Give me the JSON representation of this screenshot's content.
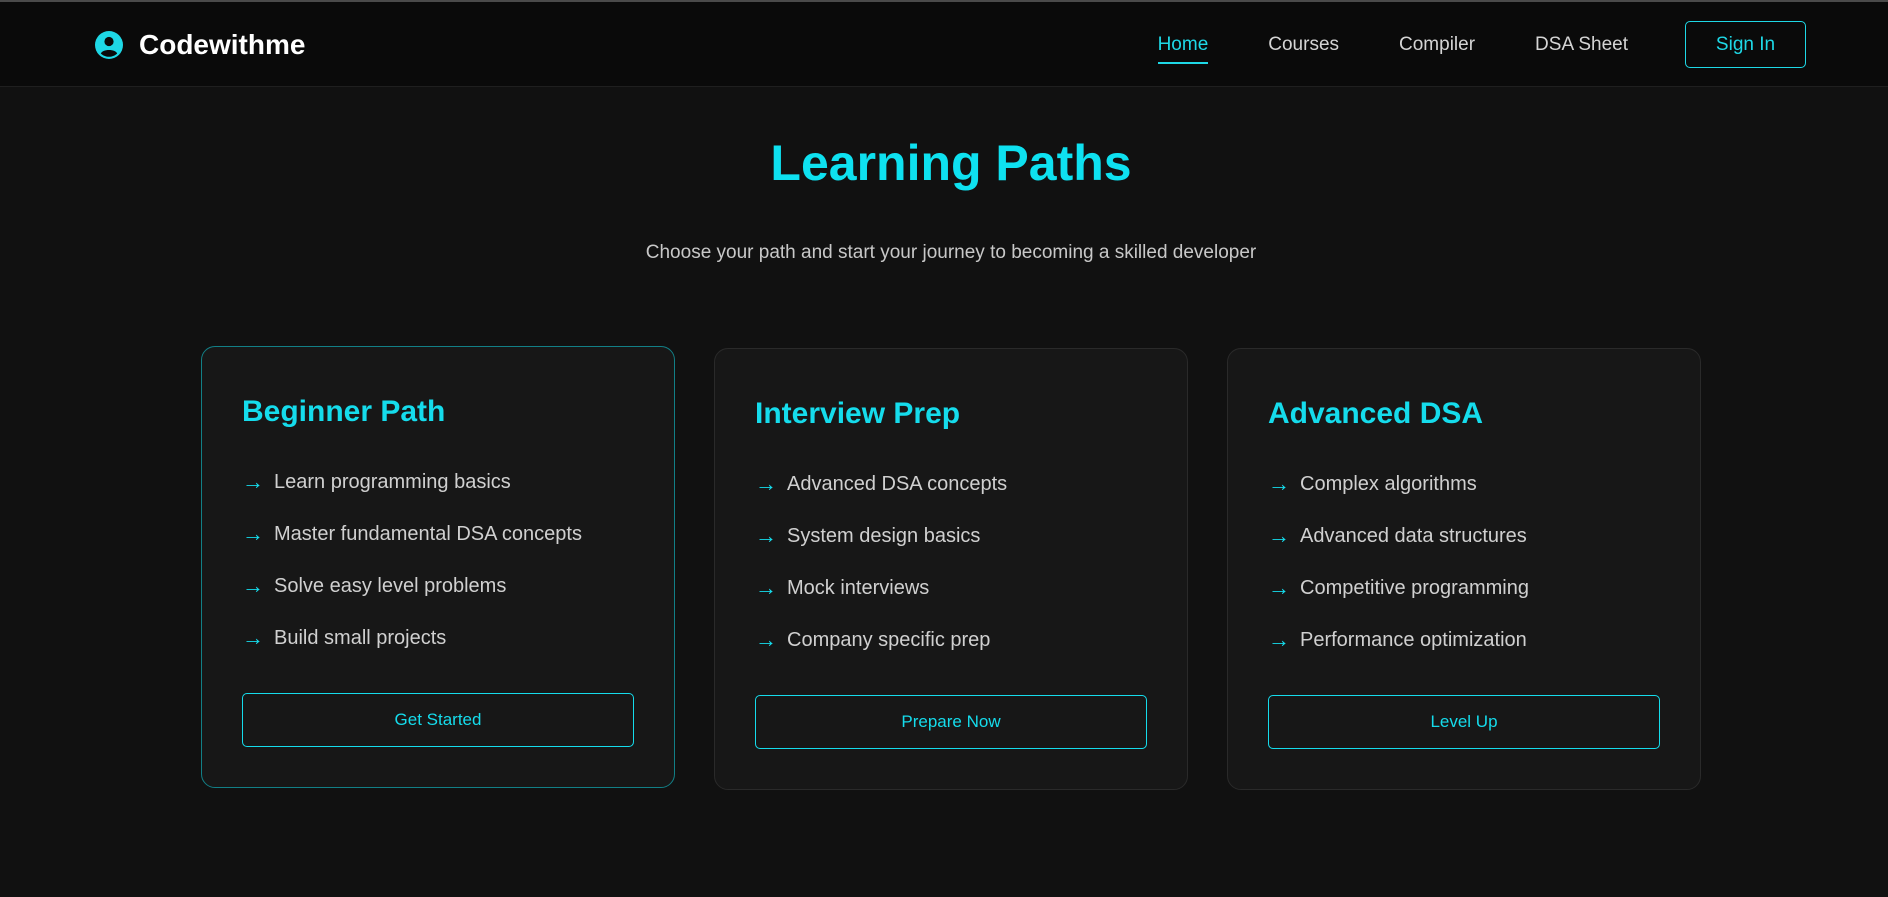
{
  "brand": {
    "name": "Codewithme",
    "icon": "user-circle-icon"
  },
  "nav": {
    "links": [
      {
        "label": "Home",
        "active": true
      },
      {
        "label": "Courses",
        "active": false
      },
      {
        "label": "Compiler",
        "active": false
      },
      {
        "label": "DSA Sheet",
        "active": false
      }
    ],
    "signin_label": "Sign In"
  },
  "hero": {
    "title": "Learning Paths",
    "subtitle": "Choose your path and start your journey to becoming a skilled developer"
  },
  "cards": [
    {
      "title": "Beginner Path",
      "highlighted": true,
      "items": [
        "Learn programming basics",
        "Master fundamental DSA concepts",
        "Solve easy level problems",
        "Build small projects"
      ],
      "button": "Get Started"
    },
    {
      "title": "Interview Prep",
      "highlighted": false,
      "items": [
        "Advanced DSA concepts",
        "System design basics",
        "Mock interviews",
        "Company specific prep"
      ],
      "button": "Prepare Now"
    },
    {
      "title": "Advanced DSA",
      "highlighted": false,
      "items": [
        "Complex algorithms",
        "Advanced data structures",
        "Competitive programming",
        "Performance optimization"
      ],
      "button": "Level Up"
    }
  ],
  "list_marker": "→",
  "colors": {
    "accent": "#15dcec",
    "background": "#111111",
    "navbar": "#0a0a0a",
    "card": "#171717"
  }
}
